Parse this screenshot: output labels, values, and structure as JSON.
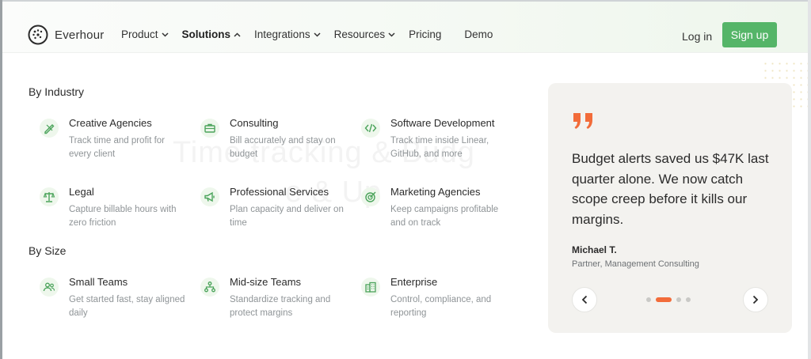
{
  "brand": {
    "name": "Everhour"
  },
  "nav": {
    "items": [
      {
        "label": "Product",
        "has_menu": true,
        "active": false
      },
      {
        "label": "Solutions",
        "has_menu": true,
        "active": true
      },
      {
        "label": "Integrations",
        "has_menu": true,
        "active": false
      },
      {
        "label": "Resources",
        "has_menu": true,
        "active": false
      },
      {
        "label": "Pricing",
        "has_menu": false,
        "active": false
      },
      {
        "label": "Demo",
        "has_menu": false,
        "active": false
      }
    ],
    "login_label": "Log in",
    "signup_label": "Sign up"
  },
  "menu": {
    "by_industry_title": "By Industry",
    "by_size_title": "By Size",
    "industry": [
      {
        "title": "Creative Agencies",
        "desc": "Track time and profit for every client",
        "icon": "pencil-ruler-icon"
      },
      {
        "title": "Consulting",
        "desc": "Bill accurately and stay on budget",
        "icon": "briefcase-icon"
      },
      {
        "title": "Software Development",
        "desc": "Track time inside Linear, GitHub, and more",
        "icon": "code-icon"
      },
      {
        "title": "Legal",
        "desc": "Capture billable hours with zero friction",
        "icon": "scales-icon"
      },
      {
        "title": "Professional Services",
        "desc": "Plan capacity and deliver on time",
        "icon": "megaphone-icon"
      },
      {
        "title": "Marketing Agencies",
        "desc": "Keep campaigns profitable and on track",
        "icon": "target-icon"
      }
    ],
    "size": [
      {
        "title": "Small Teams",
        "desc": "Get started fast, stay aligned daily",
        "icon": "users-icon"
      },
      {
        "title": "Mid-size Teams",
        "desc": "Standardize tracking and protect margins",
        "icon": "org-chart-icon"
      },
      {
        "title": "Enterprise",
        "desc": "Control, compliance, and reporting",
        "icon": "building-icon"
      }
    ]
  },
  "testimonial": {
    "quote": "Budget alerts saved us $47K last quarter alone. We now catch scope creep before it kills our margins.",
    "author": "Michael T.",
    "role": "Partner, Management Consulting",
    "current_slide": 2,
    "slide_count": 4
  },
  "colors": {
    "accent": "#55b568",
    "quote_accent": "#f26c3a",
    "icon_green": "#4aa35a"
  }
}
